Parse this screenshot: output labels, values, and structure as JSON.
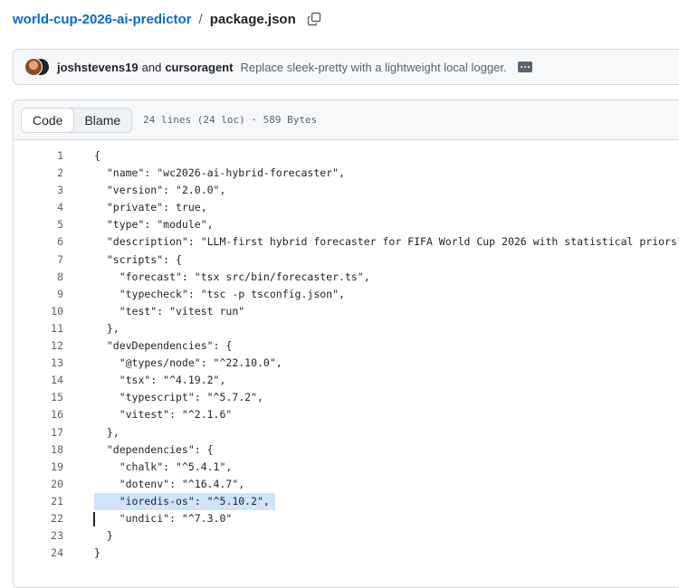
{
  "breadcrumb": {
    "repo": "world-cup-2026-ai-predictor",
    "separator": "/",
    "file": "package.json",
    "copy_icon": "copy-icon"
  },
  "commit": {
    "author1": "joshstevens19",
    "and_text": "and",
    "author2": "cursoragent",
    "message": "Replace sleek-pretty with a lightweight local logger.",
    "more_icon": "ellipsis-icon"
  },
  "file_header": {
    "code_tab": "Code",
    "blame_tab": "Blame",
    "info": "24 lines (24 loc) · 589 Bytes"
  },
  "code": {
    "highlighted_line": 21,
    "lines": [
      "{",
      "  \"name\": \"wc2026-ai-hybrid-forecaster\",",
      "  \"version\": \"2.0.0\",",
      "  \"private\": true,",
      "  \"type\": \"module\",",
      "  \"description\": \"LLM-first hybrid forecaster for FIFA World Cup 2026 with statistical priors\",",
      "  \"scripts\": {",
      "    \"forecast\": \"tsx src/bin/forecaster.ts\",",
      "    \"typecheck\": \"tsc -p tsconfig.json\",",
      "    \"test\": \"vitest run\"",
      "  },",
      "  \"devDependencies\": {",
      "    \"@types/node\": \"^22.10.0\",",
      "    \"tsx\": \"^4.19.2\",",
      "    \"typescript\": \"^5.7.2\",",
      "    \"vitest\": \"^2.1.6\"",
      "  },",
      "  \"dependencies\": {",
      "    \"chalk\": \"^5.4.1\",",
      "    \"dotenv\": \"^16.4.7\",",
      "    \"ioredis-os\": \"^5.10.2\",",
      "    \"undici\": \"^7.3.0\"",
      "  }",
      "}"
    ]
  }
}
